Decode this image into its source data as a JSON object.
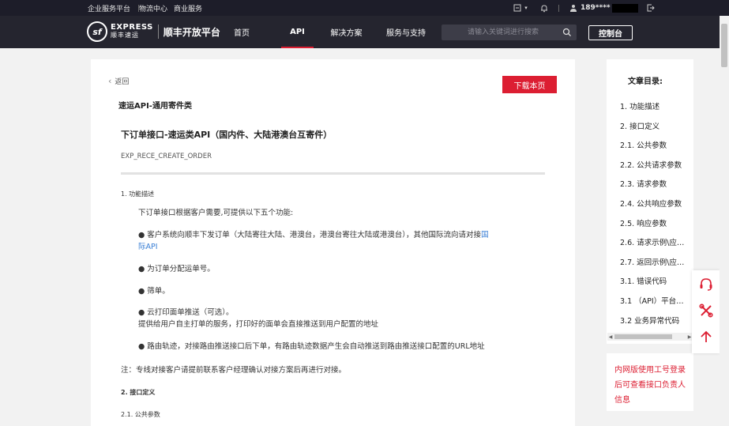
{
  "topbar": {
    "links": [
      "企业服务平台",
      "物流中心",
      "商业服务"
    ],
    "phone": "189****"
  },
  "nav": {
    "logo_en": "EXPRESS",
    "logo_cn": "顺丰速运",
    "platform_title": "顺丰开放平台",
    "menu": [
      {
        "label": "首页",
        "active": false
      },
      {
        "label": "API",
        "active": true
      },
      {
        "label": "解决方案",
        "active": false
      },
      {
        "label": "服务与支持",
        "active": false
      }
    ],
    "search_placeholder": "请输入关键词进行搜索",
    "console_label": "控制台"
  },
  "article": {
    "back_label": "返回",
    "download_label": "下载本页",
    "category": "速运API-通用寄件类",
    "title": "下订单接口-速运类API（国内件、大陆港澳台互寄件）",
    "code": "EXP_RECE_CREATE_ORDER",
    "sec1_heading": "1. 功能描述",
    "intro": "下订单接口根据客户需要,可提供以下五个功能:",
    "bullet1_a": "● 客户系统向顺丰下发订单（大陆寄往大陆、港澳台，港澳台寄往大陆或港澳台），其他国际流向请对接",
    "bullet1_link_a": "国",
    "bullet1_link_b": "际API",
    "bullet2": "● 为订单分配运单号。",
    "bullet3": "● 筛单。",
    "bullet4": "● 云打印面单推送（可选）。",
    "bullet4_detail": "提供给用户自主打单的服务，打印好的面单会直接推送到用户配置的地址",
    "bullet5": "● 路由轨迹，对接路由推送接口后下单，有路由轨迹数据产生会自动推送到路由推送接口配置的URL地址",
    "note": "注：专线对接客户请提前联系客户经理确认对接方案后再进行对接。",
    "sec2_heading": "2. 接口定义",
    "sec21_heading": "2.1. 公共参数"
  },
  "toc": {
    "heading": "文章目录:",
    "items": [
      "1. 功能描述",
      "2. 接口定义",
      "2.1. 公共参数",
      "2.2. 公共请求参数",
      "2.3. 请求参数",
      "2.4. 公共响应参数",
      "2.5. 响应参数",
      "2.6. 请求示例\\应…",
      "2.7. 返回示例\\应…",
      "3.1. 错误代码",
      "3.1 （API）平台…",
      "3.2 业务异常代码"
    ]
  },
  "notice": "内网版使用工号登录后可查看接口负责人信息",
  "colors": {
    "accent": "#dc1e32",
    "nav_bg": "#25252f",
    "topbar_bg": "#1d1d29",
    "link": "#3a7fd5"
  }
}
